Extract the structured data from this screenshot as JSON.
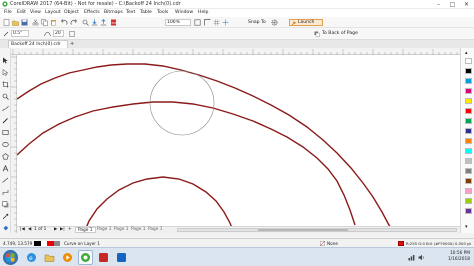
{
  "window": {
    "title": "CorelDRAW 2017 (64-Bit) - Not for resale) - C:\\Backoff 24 Inch(0).cdr"
  },
  "menu": [
    "File",
    "Edit",
    "View",
    "Layout",
    "Object",
    "Effects",
    "Bitmaps",
    "Text",
    "Table",
    "Tools",
    "Window",
    "Help"
  ],
  "toolbar": {
    "zoom": "106%",
    "snap_label": "Snap To",
    "launch_label": "Launch"
  },
  "propbar": {
    "outline_width": "0.5\"",
    "nodes_value": "20",
    "back_of_page_label": "To Back of Page"
  },
  "document": {
    "tab_label": "Backoff 24 Inch(0).cdr"
  },
  "pages": {
    "counter": "1 of 1",
    "page1_label": "Page 1",
    "page_tabs": [
      "Page 1",
      "Page 1",
      "Page 1",
      "Page 1"
    ]
  },
  "status": {
    "coordinates": "4.749, 13.579",
    "object_info": "Curve on Layer 1",
    "fill_label": "None",
    "outline_info": "R:255 G:0 B:0 (#FF0000)  0.500 pt"
  },
  "clock": {
    "time": "10:56 PM",
    "date": "1/16/2018"
  },
  "colors": {
    "curve": "#8b1a1a",
    "accent": "#2c6fbe",
    "outline_swatch": "#dd1111"
  },
  "palette_colors": [
    "#ffffff",
    "#000000",
    "#00a0e0",
    "#e0007a",
    "#ffe600",
    "#ff0000",
    "#00a651",
    "#2e3192",
    "#ff7f00",
    "#00ffff",
    "#c0c0c0",
    "#808080",
    "#7f3f00",
    "#ff99cc",
    "#99cc00",
    "#663399"
  ]
}
